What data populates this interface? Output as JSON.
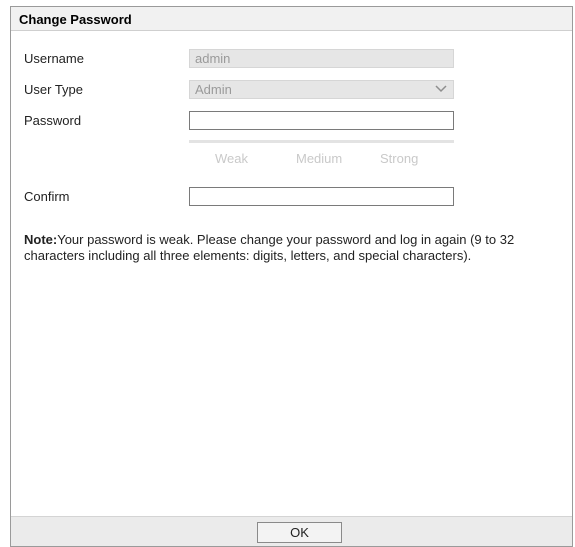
{
  "dialog": {
    "title": "Change Password"
  },
  "form": {
    "username": {
      "label": "Username",
      "value": "admin"
    },
    "user_type": {
      "label": "User Type",
      "value": "Admin",
      "icon": "chevron-down-icon"
    },
    "password": {
      "label": "Password",
      "value": ""
    },
    "strength": {
      "weak": "Weak",
      "medium": "Medium",
      "strong": "Strong"
    },
    "confirm": {
      "label": "Confirm",
      "value": ""
    }
  },
  "note": {
    "prefix": "Note:",
    "text": "Your password is weak. Please change your password and log in again (9 to 32 characters including all three elements: digits, letters, and special characters)."
  },
  "footer": {
    "ok_label": "OK"
  },
  "colors": {
    "title_bar": "#f1f1f1",
    "footer": "#ebebeb",
    "disabled_field": "#e6e6e6",
    "strength_text": "#c9c9c9"
  }
}
